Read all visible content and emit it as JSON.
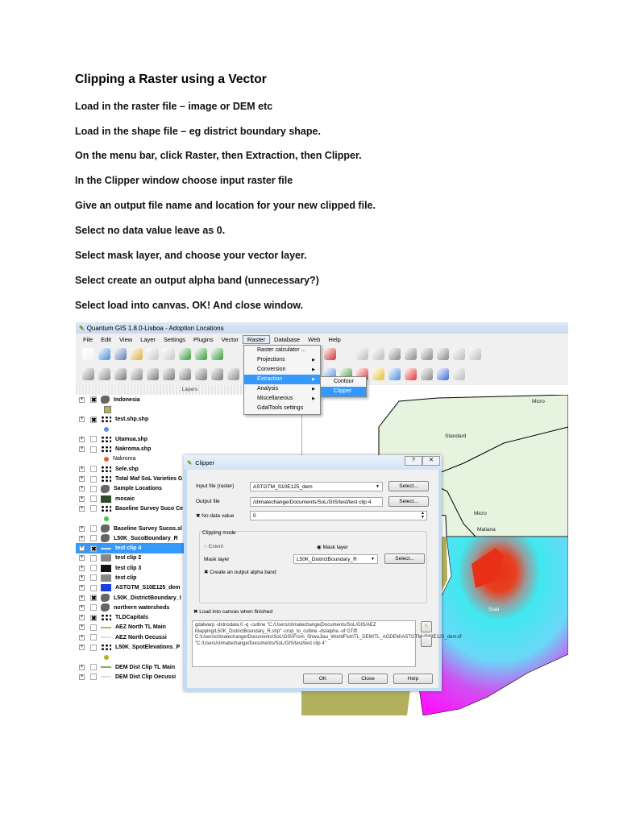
{
  "document": {
    "title": "Clipping a Raster using a Vector",
    "steps": [
      "Load in the raster file – image or DEM etc",
      "Load in the shape file – eg district boundary shape.",
      "On the menu bar, click Raster, then Extraction, then Clipper.",
      "In the Clipper window choose input raster file",
      "Give an output file name and location for your new clipped file.",
      "Select no data value leave as 0.",
      "Select mask layer, and choose your vector layer.",
      "Select create an output alpha band (unnecessary?)",
      "Select load into canvas.  OK! And close window."
    ]
  },
  "qgis": {
    "window_title": "Quantum GIS 1.8.0-Lisboa - Adoption Locations",
    "menu": [
      "File",
      "Edit",
      "View",
      "Layer",
      "Settings",
      "Plugins",
      "Vector",
      "Raster",
      "Database",
      "Web",
      "Help"
    ],
    "raster_menu": [
      "Raster calculator ...",
      "Projections",
      "Conversion",
      "Extraction",
      "Analysis",
      "Miscellaneous",
      "GdalTools settings"
    ],
    "extraction_submenu": [
      "Contour",
      "Clipper"
    ],
    "layers_header": "Layers",
    "layers": [
      {
        "label": "Indonesia",
        "checked": true,
        "icon": "polygon",
        "color": "#666"
      },
      {
        "label": "",
        "sub": true,
        "icon": "swatch",
        "color": "#b5b356"
      },
      {
        "label": "test.shp.shp",
        "checked": true,
        "icon": "points",
        "color": "#000"
      },
      {
        "label": "",
        "sub": true,
        "icon": "dot",
        "color": "#5b8fd6"
      },
      {
        "label": "Utamua.shp",
        "checked": false,
        "icon": "points",
        "color": "#000"
      },
      {
        "label": "Nakroma.shp",
        "checked": false,
        "icon": "points",
        "color": "#000"
      },
      {
        "label": "Nakroma",
        "sub": true,
        "icon": "dot",
        "color": "#e0602a"
      },
      {
        "label": "Sele.shp",
        "checked": false,
        "icon": "points",
        "color": "#000"
      },
      {
        "label": "Total Maf SoL Varieties G",
        "checked": false,
        "icon": "points",
        "color": "#000"
      },
      {
        "label": "Sample Locations",
        "checked": false,
        "icon": "polygon",
        "color": "#666"
      },
      {
        "label": "mosaic",
        "checked": false,
        "icon": "raster",
        "color": "#2d4a2d"
      },
      {
        "label": "Baseline Survey Suco Ce",
        "checked": false,
        "icon": "points",
        "color": "#000"
      },
      {
        "label": "",
        "sub": true,
        "icon": "dot",
        "color": "#3ccc3c"
      },
      {
        "label": "Baseline Survey Sucos.sl",
        "checked": false,
        "icon": "polygon",
        "color": "#666"
      },
      {
        "label": "L50K_SucoBoundary_R",
        "checked": false,
        "icon": "polygon",
        "color": "#666"
      },
      {
        "label": "test clip 4",
        "checked": true,
        "icon": "line",
        "color": "#ddd",
        "selected": true
      },
      {
        "label": "test clip 2",
        "checked": false,
        "icon": "raster",
        "color": "#888"
      },
      {
        "label": "test clip 3",
        "checked": false,
        "icon": "raster",
        "color": "#111"
      },
      {
        "label": "test clip",
        "checked": false,
        "icon": "raster",
        "color": "#888"
      },
      {
        "label": "ASTGTM_S10E125_dem",
        "checked": false,
        "icon": "raster",
        "color": "#1a3ee0"
      },
      {
        "label": "L50K_DistrictBoundary_I",
        "checked": true,
        "icon": "polygon",
        "color": "#666"
      },
      {
        "label": "northern watersheds",
        "checked": false,
        "icon": "polygon",
        "color": "#666"
      },
      {
        "label": "TLDCapitals",
        "checked": true,
        "icon": "points",
        "color": "#000"
      },
      {
        "label": "AEZ North TL Main",
        "checked": false,
        "icon": "line",
        "color": "#b5b356"
      },
      {
        "label": "AEZ North Oecussi",
        "checked": false,
        "icon": "line",
        "color": "#ddd"
      },
      {
        "label": "L50K_SpotElevations_P",
        "checked": false,
        "icon": "points",
        "color": "#000"
      },
      {
        "label": "",
        "sub": true,
        "icon": "dot",
        "color": "#b5b316"
      },
      {
        "label": "DEM Dist Clip TL Main",
        "checked": false,
        "icon": "line",
        "color": "#7ab35a"
      },
      {
        "label": "DEM Dist Clip Oecussi",
        "checked": false,
        "icon": "line",
        "color": "#ddd"
      }
    ],
    "map_labels": [
      "Micro",
      "Standard",
      "Micro",
      "Maliana",
      "Suai"
    ],
    "clipper": {
      "title": "Clipper",
      "help_btn": "?",
      "close_btn": "✕",
      "input_label": "Input file (raster)",
      "input_value": "ASTGTM_S10E125_dem",
      "select_label": "Select...",
      "output_label": "Output file",
      "output_value": "/climatechange/Documents/SoL/GIS/test/test clip 4",
      "nodata_label": "No data value",
      "nodata_value": "0",
      "clipping_mode": "Clipping mode",
      "extent": "Extent",
      "mask_radio": "Mask layer",
      "mask_label": "Mask layer",
      "mask_value": "L50K_DistrictBoundary_R",
      "alpha_label": "Create an output alpha band",
      "load_label": "Load into canvas when finished",
      "command": "gdalwarp -dstnodata 0 -q -cutline \"C:/Users/climatechange/Documents/SoL/GIS/AEZ Mapping/L50K_DistrictBoundary_R.shp\" -crop_to_cutline -dstalpha -of GTiff C:\\Users\\climatechange\\Documents\\SoL\\GIS\\From_ShwuJiau_WorldFish\\TL_DEM\\TL_AGDEM\\ASTGTM_S10E125_dem.tif \"C:/Users/climatechange/Documents/SoL/GIS/test/test clip 4\"",
      "ok": "OK",
      "close": "Close",
      "help": "Help"
    }
  }
}
